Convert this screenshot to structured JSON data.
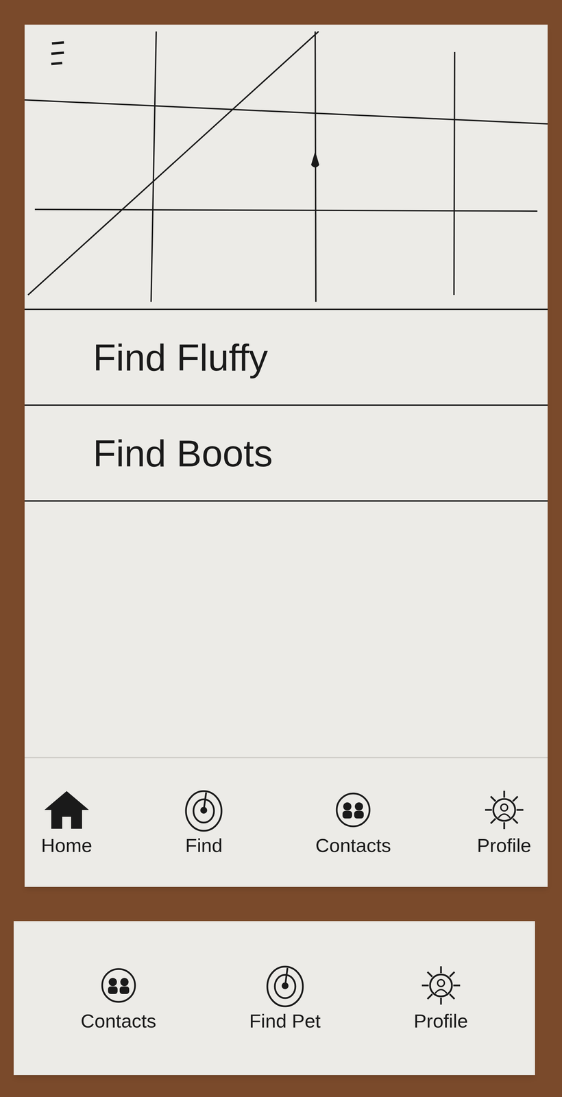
{
  "pets": [
    {
      "label": "Find Fluffy"
    },
    {
      "label": "Find Boots"
    }
  ],
  "nav": [
    {
      "label": "Home",
      "kind": "home"
    },
    {
      "label": "Find",
      "kind": "find"
    },
    {
      "label": "Contacts",
      "kind": "contacts"
    },
    {
      "label": "Profile",
      "kind": "profile"
    }
  ],
  "alt_nav": [
    {
      "label": "Contacts",
      "kind": "contacts"
    },
    {
      "label": "Find Pet",
      "kind": "find"
    },
    {
      "label": "Profile",
      "kind": "profile"
    }
  ]
}
